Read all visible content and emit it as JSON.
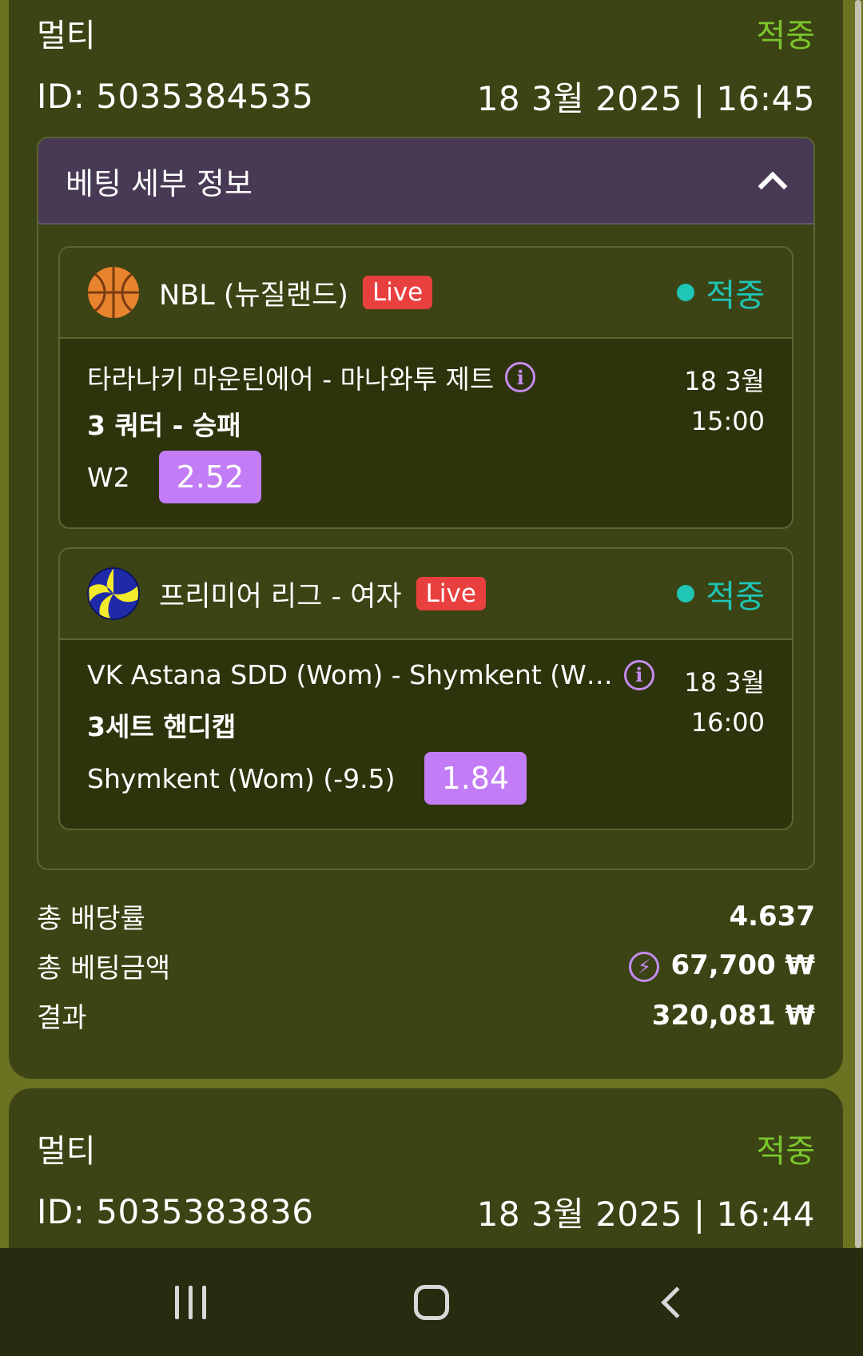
{
  "bets": [
    {
      "type": "멀티",
      "status": "적중",
      "id": "ID: 5035384535",
      "datetime": "18 3월 2025 | 16:45",
      "details_title": "베팅 세부 정보",
      "events": [
        {
          "sport_icon": "basketball-icon",
          "league": "NBL (뉴질랜드)",
          "live": "Live",
          "status": "적중",
          "match": "타라나키 마운틴에어 - 마나와투 제트",
          "market": "3 쿼터 - 승패",
          "date": "18 3월",
          "time": "15:00",
          "selection": "W2",
          "odds": "2.52"
        },
        {
          "sport_icon": "volleyball-icon",
          "league": "프리미어 리그 - 여자",
          "live": "Live",
          "status": "적중",
          "match": "VK Astana SDD (Wom) - Shymkent (W…",
          "market": "3세트 핸디캡",
          "date": "18 3월",
          "time": "16:00",
          "selection": "Shymkent (Wom) (-9.5)",
          "odds": "1.84"
        }
      ],
      "summary": {
        "total_odds_label": "총 배당률",
        "total_odds": "4.637",
        "total_stake_label": "총 베팅금액",
        "total_stake": "67,700 ₩",
        "result_label": "결과",
        "result": "320,081 ₩"
      }
    },
    {
      "type": "멀티",
      "status": "적중",
      "id": "ID: 5035383836",
      "datetime": "18 3월 2025 | 16:44"
    }
  ],
  "colors": {
    "status_won": "#7bc62d",
    "event_won": "#1fc5b5",
    "odds_bg": "#c27cf5",
    "live_bg": "#e8403f"
  }
}
